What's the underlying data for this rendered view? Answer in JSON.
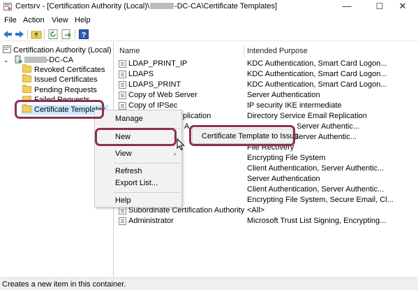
{
  "window": {
    "title_prefix": "Certsrv - [Certification Authority (Local)\\",
    "title_suffix": "-DC-CA\\Certificate Templates]",
    "minimize": "—",
    "maximize": "☐",
    "close": "✕"
  },
  "menubar": {
    "file": "File",
    "action": "Action",
    "view": "View",
    "help": "Help"
  },
  "tree": {
    "root": "Certification Authority (Local)",
    "ca_suffix": "-DC-CA",
    "items": [
      {
        "label": "Revoked Certificates"
      },
      {
        "label": "Issued Certificates"
      },
      {
        "label": "Pending Requests"
      },
      {
        "label": "Failed Requests"
      },
      {
        "label": "Certificate Templates"
      }
    ]
  },
  "list": {
    "col_name": "Name",
    "col_purpose": "Intended Purpose",
    "rows": [
      {
        "name": "LDAP_PRINT_IP",
        "purpose": "KDC Authentication, Smart Card Logon..."
      },
      {
        "name": "LDAPS",
        "purpose": "KDC Authentication, Smart Card Logon..."
      },
      {
        "name": "LDAPS_PRINT",
        "purpose": "KDC Authentication, Smart Card Logon..."
      },
      {
        "name": "Copy of Web Server",
        "purpose": "Server Authentication"
      },
      {
        "name": "Copy of IPSec",
        "purpose": "IP security IKE intermediate"
      },
      {
        "name": "plication",
        "purpose": "Directory Service Email Replication"
      },
      {
        "name": "A",
        "purpose": ", Server Authentic..."
      },
      {
        "name": "",
        "purpose": "",
        "purpose_right": "Server Authentic..."
      },
      {
        "name": "",
        "purpose": "File Recovery"
      },
      {
        "name": "",
        "purpose": "Encrypting File System"
      },
      {
        "name": "",
        "purpose": "Client Authentication, Server Authentic..."
      },
      {
        "name": "",
        "purpose": "Server Authentication"
      },
      {
        "name": "",
        "purpose": "Client Authentication, Server Authentic..."
      },
      {
        "name": "",
        "purpose": "Encrypting File System, Secure Email, Cl..."
      },
      {
        "name": "Subordinate Certification Authority",
        "purpose": "<All>"
      },
      {
        "name": "Administrator",
        "purpose": "Microsoft Trust List Signing, Encrypting..."
      }
    ]
  },
  "context_menu": {
    "manage": "Manage",
    "new": "New",
    "view": "View",
    "refresh": "Refresh",
    "export": "Export List...",
    "help": "Help",
    "arrow": "›"
  },
  "submenu": {
    "item": "Certificate Template to Issue"
  },
  "status": "Creates a new item in this container.",
  "colors": {
    "highlight": "#8f2d58",
    "folder": "#f2cd61",
    "selection": "#cce8ff"
  },
  "icons": [
    "app-icon",
    "back-arrow-icon",
    "forward-arrow-icon",
    "up-folder-icon",
    "refresh-icon",
    "export-icon",
    "help-icon",
    "ca-server-icon",
    "folder-icon",
    "template-icon",
    "mouse-cursor-icon"
  ]
}
